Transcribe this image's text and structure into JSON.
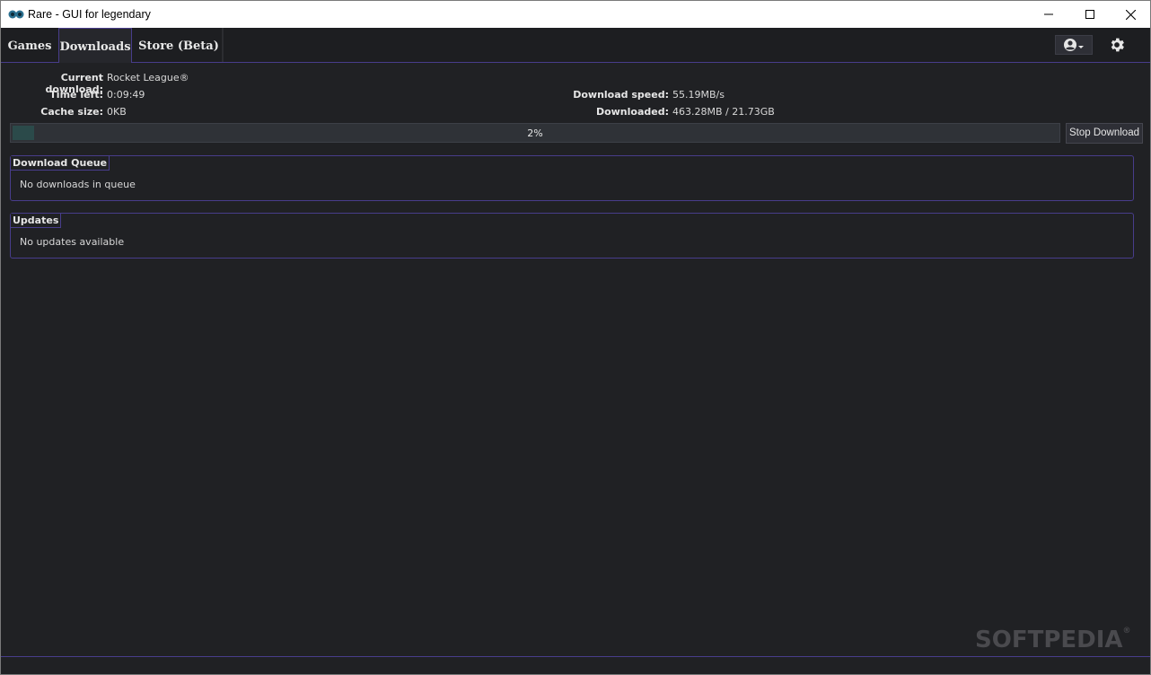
{
  "window": {
    "title": "Rare - GUI for legendary"
  },
  "tabs": [
    {
      "label": "Games"
    },
    {
      "label": "Downloads"
    },
    {
      "label": "Store (Beta)"
    }
  ],
  "download": {
    "current_label": "Current download:",
    "current_value": "Rocket League®",
    "time_left_label": "Time left:",
    "time_left_value": "0:09:49",
    "cache_label": "Cache size:",
    "cache_value": "0KB",
    "speed_label": "Download speed:",
    "speed_value": "55.19MB/s",
    "downloaded_label": "Downloaded:",
    "downloaded_value": "463.28MB / 21.73GB",
    "progress_percent": 2,
    "progress_text": "2%",
    "stop_label": "Stop Download"
  },
  "queue": {
    "title": "Download Queue",
    "empty_text": "No downloads in queue"
  },
  "updates": {
    "title": "Updates",
    "empty_text": "No updates available"
  },
  "watermark": "SOFTPEDIA",
  "icons": {
    "app": "rare-logo-icon",
    "account": "account-circle-icon",
    "settings": "gear-icon"
  },
  "colors": {
    "accent": "#483d8b",
    "background": "#202124",
    "progress_fill": "#2b4a4a"
  }
}
